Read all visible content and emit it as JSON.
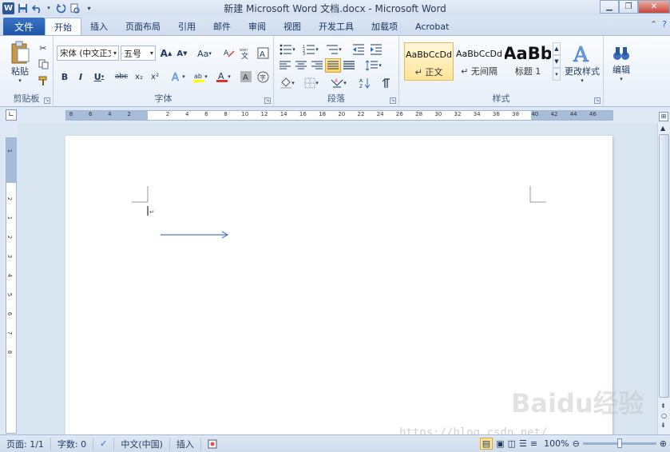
{
  "window": {
    "title": "新建 Microsoft Word 文档.docx - Microsoft Word"
  },
  "tabs": {
    "file": "文件",
    "items": [
      "开始",
      "插入",
      "页面布局",
      "引用",
      "邮件",
      "审阅",
      "视图",
      "开发工具",
      "加载项",
      "Acrobat"
    ],
    "active": "开始"
  },
  "clipboard": {
    "paste_label": "粘贴",
    "group_label": "剪贴板"
  },
  "font": {
    "font_name": "宋体 (中文正文",
    "font_size": "五号",
    "group_label": "字体",
    "grow_label": "A",
    "shrink_label": "A",
    "case_label": "Aa",
    "bold": "B",
    "italic": "I",
    "underline": "U",
    "strike": "abc",
    "sub": "x₂",
    "sup": "x²",
    "clear_format": "A"
  },
  "paragraph": {
    "group_label": "段落"
  },
  "styles": {
    "group_label": "样式",
    "items": [
      {
        "preview": "AaBbCcDd",
        "name": "↵ 正文"
      },
      {
        "preview": "AaBbCcDd",
        "name": "↵ 无间隔"
      },
      {
        "preview": "AaBb",
        "name": "标题 1"
      }
    ],
    "change_styles_label": "更改样式"
  },
  "editing": {
    "label": "编辑"
  },
  "ruler": {
    "h_numbers": [
      "8",
      "6",
      "4",
      "2",
      "2",
      "4",
      "6",
      "8",
      "10",
      "12",
      "14",
      "16",
      "18",
      "20",
      "22",
      "24",
      "26",
      "28",
      "30",
      "32",
      "34",
      "36",
      "38",
      "40",
      "42",
      "44",
      "46",
      "48"
    ],
    "v_numbers": [
      "1",
      "2",
      "1",
      "2",
      "3",
      "4",
      "5",
      "6",
      "7",
      "8"
    ]
  },
  "statusbar": {
    "page": "页面: 1/1",
    "words": "字数: 0",
    "language": "中文(中国)",
    "mode": "插入",
    "zoom": "100%"
  },
  "watermark": {
    "brand": "Baidu经验",
    "url": "https://blog.csdn.net/..."
  }
}
